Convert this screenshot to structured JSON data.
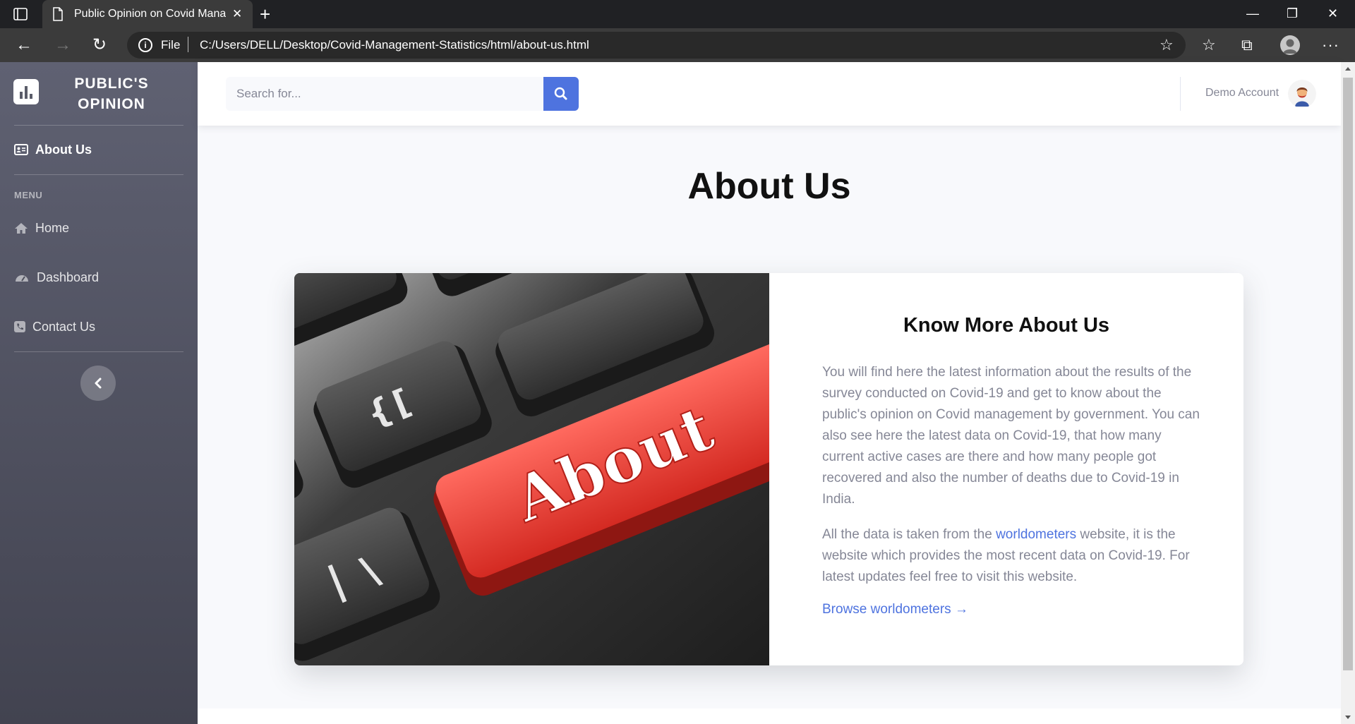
{
  "browser": {
    "tab_title": "Public Opinion on Covid Manage",
    "url_scheme": "File",
    "url": "C:/Users/DELL/Desktop/Covid-Management-Statistics/html/about-us.html"
  },
  "sidebar": {
    "brand_line1": "PUBLIC'S",
    "brand_line2": "OPINION",
    "active_item": "About Us",
    "heading": "MENU",
    "items": [
      {
        "label": "Home",
        "icon": "home-icon"
      },
      {
        "label": "Dashboard",
        "icon": "tachometer-icon"
      },
      {
        "label": "Contact Us",
        "icon": "phone-icon"
      }
    ]
  },
  "topbar": {
    "search_placeholder": "Search for...",
    "user_name": "Demo Account"
  },
  "main": {
    "title": "About Us",
    "card": {
      "image_text": "About",
      "heading": "Know More About Us",
      "p1": "You will find here the latest information about the results of the survey conducted on Covid-19 and get to know about the public's opinion on Covid management by government. You can also see here the latest data on Covid-19, that how many current active cases are there and how many people got recovered and also the number of deaths due to Covid-19 in India.",
      "p2_before": "All the data is taken from the ",
      "p2_link": "worldometers",
      "p2_after": " website, it is the website which provides the most recent data on Covid-19. For latest updates feel free to visit this website.",
      "browse_link": "Browse worldometers →"
    }
  },
  "colors": {
    "primary": "#4e73df",
    "sidebar_top": "#5f6172",
    "sidebar_bottom": "#424350",
    "text_muted": "#858796",
    "about_key": "#e8413c"
  }
}
